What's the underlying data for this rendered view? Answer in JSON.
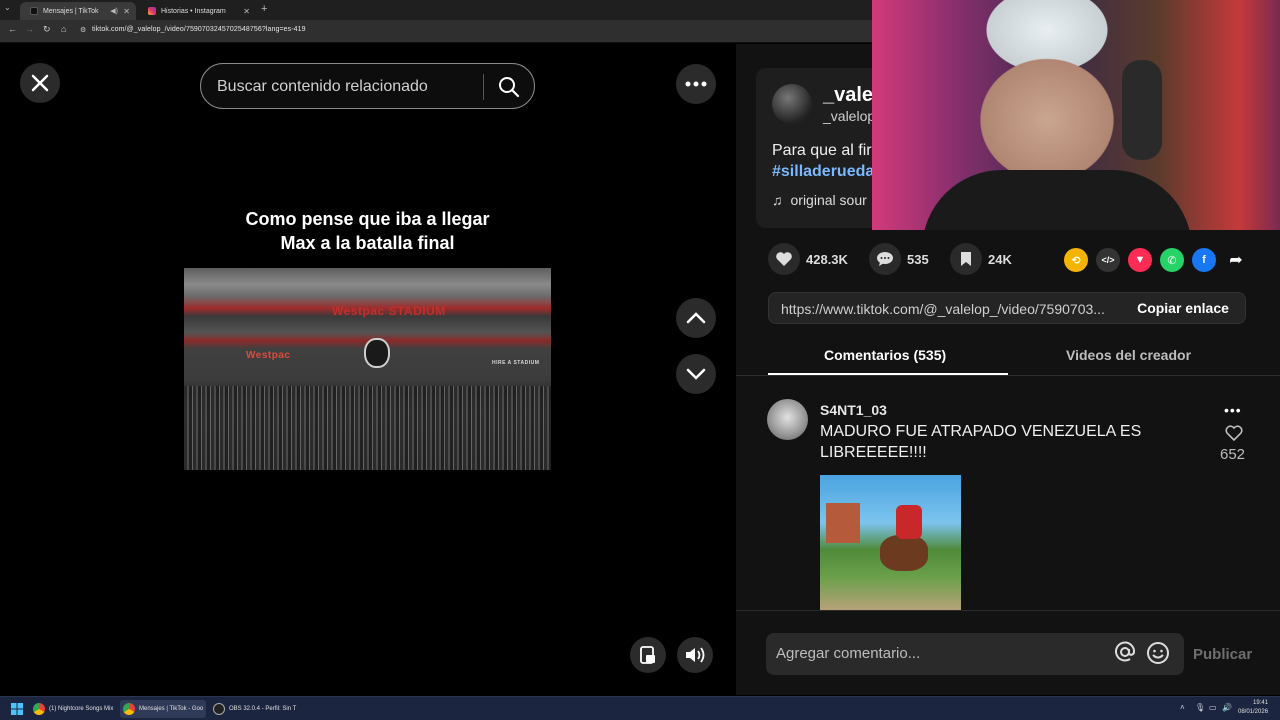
{
  "browser": {
    "tabs": [
      {
        "label": "Mensajes | TikTok",
        "active": true
      },
      {
        "label": "Historias • Instagram",
        "active": false
      }
    ],
    "new_tab": "+",
    "url": "tiktok.com/@_valelop_/video/7590703245702548756?lang=es-419"
  },
  "search": {
    "placeholder": "Buscar contenido relacionado"
  },
  "video": {
    "caption_line1": "Como pense que iba a llegar",
    "caption_line2": "Max a la batalla final",
    "signs": [
      "Westpac STADIUM",
      "Westpac",
      "HIRE A STADIUM"
    ]
  },
  "author": {
    "name": "_valel",
    "handle": "_valelop",
    "description": "Para que al fir",
    "hashtag": "#silladerueda",
    "sound": "original sour"
  },
  "stats": {
    "likes": "428.3K",
    "comments": "535",
    "saves": "24K"
  },
  "share": {
    "link": "https://www.tiktok.com/@_valelop_/video/7590703...",
    "copy_label": "Copiar enlace"
  },
  "tabs": {
    "comments": "Comentarios (535)",
    "creator_videos": "Videos del creador"
  },
  "comment": {
    "user": "S4NT1_03",
    "text": "MADURO FUE ATRAPADO VENEZUELA ES LIBREEEEE!!!!",
    "likes": "652"
  },
  "compose": {
    "placeholder": "Agregar comentario...",
    "publish": "Publicar"
  },
  "taskbar": {
    "items": [
      "(1) Nightcore Songs Mix",
      "Mensajes | TikTok - Goo",
      "OBS 32.0.4 - Perfil: Sin T"
    ],
    "time": "19:41",
    "date": "08/01/2026"
  },
  "colors": {
    "hashtag": "#7ab8ff",
    "background": "#000000",
    "panel": "#121212"
  },
  "icons": [
    "close-icon",
    "search-icon",
    "more-icon",
    "chevron-up-icon",
    "chevron-down-icon",
    "heart-icon",
    "comment-icon",
    "bookmark-icon",
    "repost-icon",
    "embed-icon",
    "send-icon",
    "whatsapp-icon",
    "facebook-icon",
    "share-arrow-icon",
    "music-note-icon",
    "at-icon",
    "emoji-icon",
    "volume-icon",
    "miniplayer-icon"
  ]
}
